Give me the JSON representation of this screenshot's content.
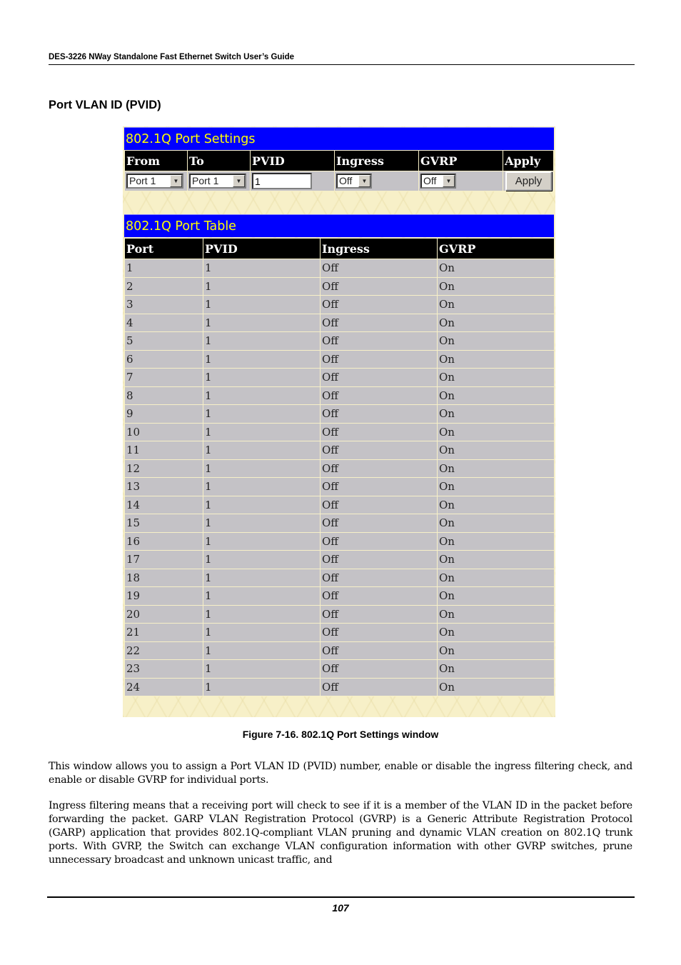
{
  "header": {
    "running_title": "DES-3226 NWay Standalone Fast Ethernet Switch User’s Guide",
    "section_title": "Port VLAN ID (PVID)"
  },
  "settings_panel": {
    "title": "802.1Q Port Settings",
    "columns": [
      "From",
      "To",
      "PVID",
      "Ingress",
      "GVRP",
      "Apply"
    ],
    "from_value": "Port 1",
    "to_value": "Port 1",
    "pvid_value": "1",
    "ingress_value": "Off",
    "gvrp_value": "Off",
    "apply_label": "Apply"
  },
  "port_table": {
    "title": "802.1Q Port Table",
    "columns": [
      "Port",
      "PVID",
      "Ingress",
      "GVRP"
    ],
    "rows": [
      [
        "1",
        "1",
        "Off",
        "On"
      ],
      [
        "2",
        "1",
        "Off",
        "On"
      ],
      [
        "3",
        "1",
        "Off",
        "On"
      ],
      [
        "4",
        "1",
        "Off",
        "On"
      ],
      [
        "5",
        "1",
        "Off",
        "On"
      ],
      [
        "6",
        "1",
        "Off",
        "On"
      ],
      [
        "7",
        "1",
        "Off",
        "On"
      ],
      [
        "8",
        "1",
        "Off",
        "On"
      ],
      [
        "9",
        "1",
        "Off",
        "On"
      ],
      [
        "10",
        "1",
        "Off",
        "On"
      ],
      [
        "11",
        "1",
        "Off",
        "On"
      ],
      [
        "12",
        "1",
        "Off",
        "On"
      ],
      [
        "13",
        "1",
        "Off",
        "On"
      ],
      [
        "14",
        "1",
        "Off",
        "On"
      ],
      [
        "15",
        "1",
        "Off",
        "On"
      ],
      [
        "16",
        "1",
        "Off",
        "On"
      ],
      [
        "17",
        "1",
        "Off",
        "On"
      ],
      [
        "18",
        "1",
        "Off",
        "On"
      ],
      [
        "19",
        "1",
        "Off",
        "On"
      ],
      [
        "20",
        "1",
        "Off",
        "On"
      ],
      [
        "21",
        "1",
        "Off",
        "On"
      ],
      [
        "22",
        "1",
        "Off",
        "On"
      ],
      [
        "23",
        "1",
        "Off",
        "On"
      ],
      [
        "24",
        "1",
        "Off",
        "On"
      ]
    ]
  },
  "caption": "Figure 7-16.  802.1Q Port Settings window",
  "paragraphs": [
    "This window allows you to assign a Port VLAN ID (PVID) number, enable or disable the ingress filtering check, and enable or disable GVRP for individual ports.",
    "Ingress filtering means that a receiving port will check to see if it is a member of the VLAN ID in the packet before forwarding the packet. GARP VLAN Registration Protocol (GVRP) is a Generic Attribute Registration Protocol (GARP) application that provides 802.1Q-compliant VLAN pruning and dynamic VLAN creation on 802.1Q trunk ports. With GVRP, the Switch can exchange VLAN configuration information with other GVRP switches, prune unnecessary broadcast and unknown unicast traffic, and"
  ],
  "footer": {
    "page_number": "107"
  },
  "colors": {
    "panel_title_bg": "#0000ff",
    "panel_title_text": "#ffff00",
    "header_bg": "#000000",
    "cell_bg": "#c4c2c6",
    "page_bg": "#f7f0c8"
  }
}
